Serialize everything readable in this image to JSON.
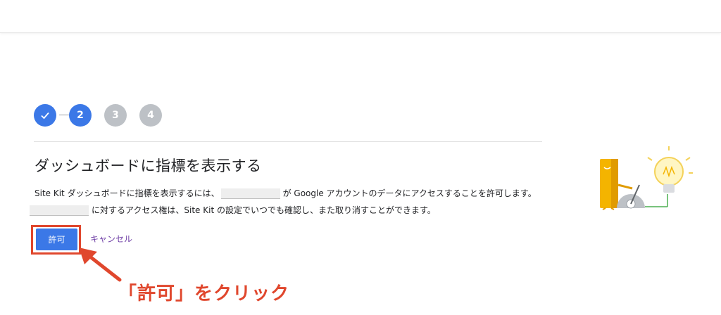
{
  "stepper": {
    "steps": [
      {
        "label": "",
        "state": "done"
      },
      {
        "label": "2",
        "state": "active"
      },
      {
        "label": "3",
        "state": "pending"
      },
      {
        "label": "4",
        "state": "pending"
      }
    ]
  },
  "page": {
    "title": "ダッシュボードに指標を表示する",
    "desc_part1": "Site Kit ダッシュボードに指標を表示するには、",
    "desc_part2": "が Google アカウントのデータにアクセスすることを許可します。",
    "desc_part3": "に対するアクセス権は、Site Kit の設定でいつでも確認し、また取り消すことができます。"
  },
  "actions": {
    "allow_label": "許可",
    "cancel_label": "キャンセル"
  },
  "annotation": {
    "text": "「許可」をクリック"
  },
  "colors": {
    "accent": "#3b78e7",
    "pending": "#bdc1c6",
    "annotation": "#e0472d",
    "link": "#6f3fa6"
  },
  "icons": {
    "step_done": "check-icon",
    "illustration": "site-kit-lightbulb-illustration"
  }
}
